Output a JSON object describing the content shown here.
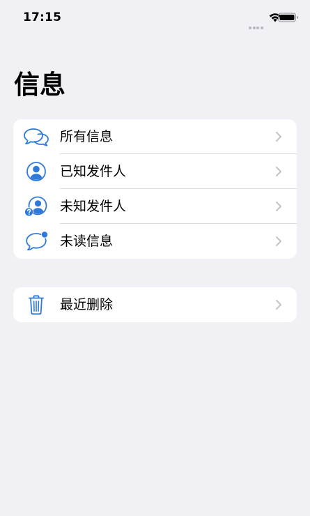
{
  "status": {
    "time": "17:15"
  },
  "title": "信息",
  "accent_color": "#2f7ad8",
  "groups": [
    {
      "items": [
        {
          "label": "所有信息",
          "icon": "chat-bubbles-icon"
        },
        {
          "label": "已知发件人",
          "icon": "person-circle-icon"
        },
        {
          "label": "未知发件人",
          "icon": "unknown-person-icon"
        },
        {
          "label": "未读信息",
          "icon": "unread-bubble-icon"
        }
      ]
    },
    {
      "items": [
        {
          "label": "最近删除",
          "icon": "trash-icon"
        }
      ]
    }
  ]
}
